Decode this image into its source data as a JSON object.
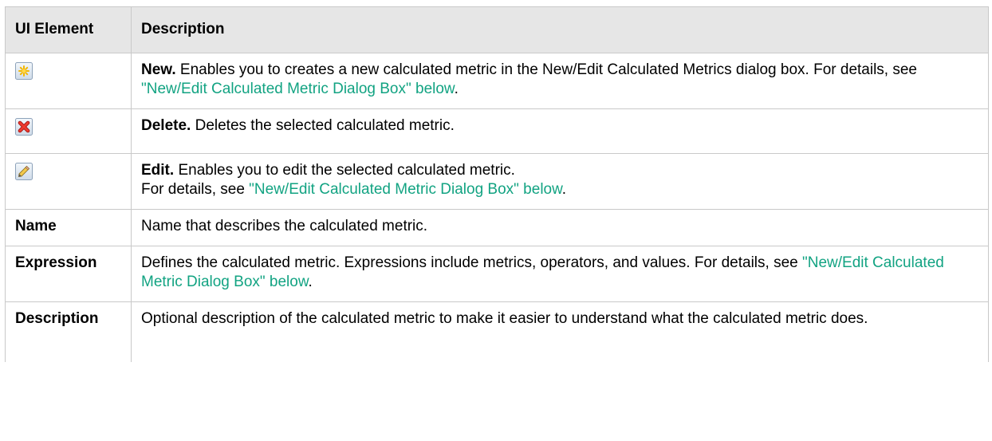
{
  "table": {
    "headers": {
      "col1": "UI Element",
      "col2": "Description"
    },
    "rows": {
      "new": {
        "icon": "new-sparkle-icon",
        "bold": "New.",
        "text1": " Enables you to creates a new calculated metric in the New/Edit Calculated Metrics dialog box. For details, see ",
        "link": "\"New/Edit Calculated Metric Dialog Box\" below",
        "tail": "."
      },
      "delete": {
        "icon": "delete-x-icon",
        "bold": "Delete.",
        "text1": " Deletes the selected calculated metric."
      },
      "edit": {
        "icon": "edit-pencil-icon",
        "bold": "Edit.",
        "text1": " Enables you to edit the selected calculated metric.",
        "text2": "For details, see ",
        "link": "\"New/Edit Calculated Metric Dialog Box\" below",
        "tail": "."
      },
      "name": {
        "label": "Name",
        "text1": "Name that describes the calculated metric."
      },
      "expression": {
        "label": "Expression",
        "text1": "Defines the calculated metric. Expressions include metrics, operators, and values. For details, see ",
        "link": "\"New/Edit Calculated Metric Dialog Box\" below",
        "tail": "."
      },
      "description": {
        "label": "Description",
        "text1": "Optional description of the calculated metric to make it easier to understand what the calculated metric does."
      }
    }
  },
  "colors": {
    "link": "#12a382",
    "header_bg": "#e6e6e6",
    "border": "#c9c9c9"
  }
}
